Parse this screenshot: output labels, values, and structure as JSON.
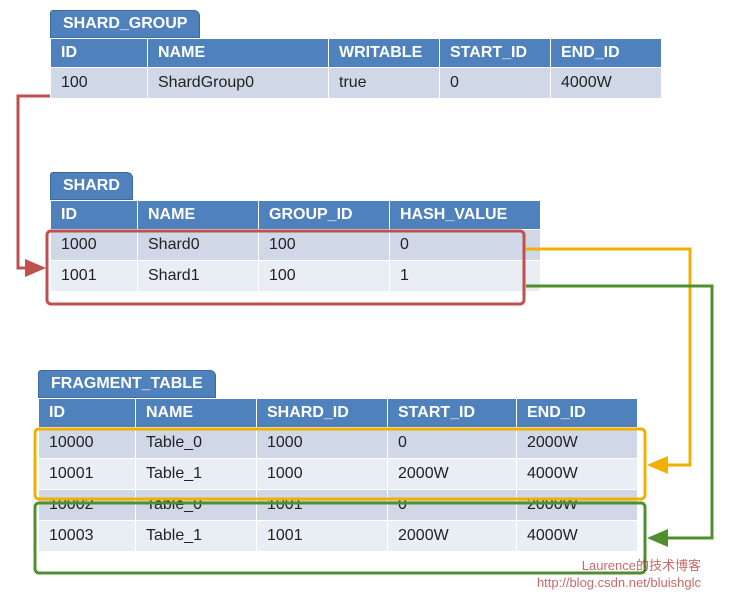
{
  "shard_group": {
    "title": "SHARD_GROUP",
    "columns": [
      "ID",
      "NAME",
      "WRITABLE",
      "START_ID",
      "END_ID"
    ],
    "rows": [
      {
        "id": "100",
        "name": "ShardGroup0",
        "writable": "true",
        "start_id": "0",
        "end_id": "4000W"
      }
    ]
  },
  "shard": {
    "title": "SHARD",
    "columns": [
      "ID",
      "NAME",
      "GROUP_ID",
      "HASH_VALUE"
    ],
    "rows": [
      {
        "id": "1000",
        "name": "Shard0",
        "group_id": "100",
        "hash_value": "0"
      },
      {
        "id": "1001",
        "name": "Shard1",
        "group_id": "100",
        "hash_value": "1"
      }
    ]
  },
  "fragment_table": {
    "title": "FRAGMENT_TABLE",
    "columns": [
      "ID",
      "NAME",
      "SHARD_ID",
      "START_ID",
      "END_ID"
    ],
    "rows": [
      {
        "id": "10000",
        "name": "Table_0",
        "shard_id": "1000",
        "start_id": "0",
        "end_id": "2000W"
      },
      {
        "id": "10001",
        "name": "Table_1",
        "shard_id": "1000",
        "start_id": "2000W",
        "end_id": "4000W"
      },
      {
        "id": "10002",
        "name": "Table_0",
        "shard_id": "1001",
        "start_id": "0",
        "end_id": "2000W"
      },
      {
        "id": "10003",
        "name": "Table_1",
        "shard_id": "1001",
        "start_id": "2000W",
        "end_id": "4000W"
      }
    ]
  },
  "watermark": {
    "line1": "Laurence的技术博客",
    "line2": "http://blog.csdn.net/bluishglc"
  },
  "chart_data": {
    "type": "table",
    "description": "Relational diagram: SHARD_GROUP row 100 links to SHARD rows (GROUP_ID=100). SHARD row 1000 links to FRAGMENT_TABLE rows with SHARD_ID=1000 (yellow box). SHARD row 1001 links to FRAGMENT_TABLE rows with SHARD_ID=1001 (green box).",
    "links": [
      {
        "from_table": "SHARD_GROUP",
        "from_row": "100",
        "to_table": "SHARD",
        "to_rows": [
          "1000",
          "1001"
        ],
        "color": "#C0504D"
      },
      {
        "from_table": "SHARD",
        "from_row": "1000",
        "to_table": "FRAGMENT_TABLE",
        "to_rows": [
          "10000",
          "10001"
        ],
        "color": "#F0B000"
      },
      {
        "from_table": "SHARD",
        "from_row": "1001",
        "to_table": "FRAGMENT_TABLE",
        "to_rows": [
          "10002",
          "10003"
        ],
        "color": "#4F8F2F"
      }
    ]
  }
}
